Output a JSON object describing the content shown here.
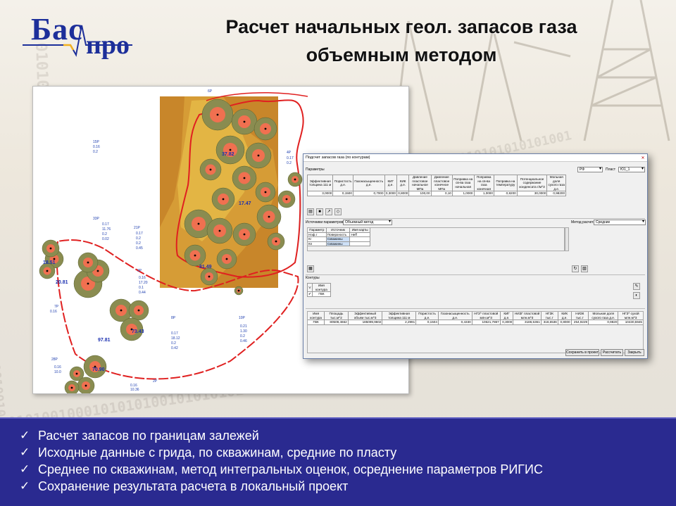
{
  "logo": {
    "part1": "Бас",
    "part2": "про"
  },
  "title": {
    "line1": "Расчет начальных геол. запасов газа",
    "line2": "объемным методом"
  },
  "background": {
    "binary_rows": [
      "0101001010101",
      "1010101010101001",
      "0101001000101010100101010101",
      "10100110101001010"
    ]
  },
  "colors": {
    "band": "#2a2a90",
    "map_orange": "#c8862a",
    "well_olive": "#8a8c50",
    "well_core": "#f07050",
    "contour_red": "#e02020"
  },
  "map": {
    "well_labels": [
      {
        "name": "15P",
        "vals": [
          "0.16",
          "0.2"
        ]
      },
      {
        "name": "16P",
        "vals": [
          "0.16"
        ]
      },
      {
        "name": "33P",
        "vals": [
          "0.17",
          "11.76",
          "0.2",
          "0.02"
        ]
      },
      {
        "name": "21P",
        "vals": [
          "0.17",
          "0.2",
          "0.2",
          "0.45"
        ]
      },
      {
        "name": "3P",
        "vals": [
          "0.16",
          "17.20",
          "0.1",
          "0.44"
        ]
      },
      {
        "name": "8P",
        "vals": [
          "0.17",
          "18.12",
          "0.2",
          "0.42"
        ]
      },
      {
        "name": "10P",
        "vals": [
          "0.21",
          "1.30",
          "0.2",
          "0.46"
        ]
      },
      {
        "name": "2P",
        "vals": [
          "0.16",
          "10.36",
          "0.1"
        ]
      },
      {
        "name": "28P",
        "vals": [
          "0.16",
          "10.0",
          "0.2"
        ]
      },
      {
        "name": "7P",
        "vals": [
          "0.16"
        ]
      },
      {
        "name": "4P",
        "vals": [
          "0.17",
          "0.2",
          "0.47"
        ]
      },
      {
        "name": "6P",
        "vals": [
          "0.15",
          "0.4",
          "0.47"
        ]
      }
    ],
    "big_values": [
      "70.90",
      "97.81",
      "73.43",
      "20.81",
      "18.51",
      "37.82",
      "17.47",
      "81.49"
    ]
  },
  "dialog": {
    "title": "Подсчет запасов газа (по контурам)",
    "params_label": "Параметры",
    "rb_value": "РФ",
    "plast_label": "Пласт",
    "plast_value": "Ю1_1",
    "params_headers": [
      "Эффективная толщина 111 м",
      "Пористость д.е.",
      "Газонасыщенность д.е.",
      "КИГ д.е.",
      "КИК д.е.",
      "Давление пластовое начальное МПа",
      "Давление пластовое конечное МПа",
      "Поправка на св-ва газа начальная",
      "Поправка на св-ва газа конечная",
      "Поправка на температуру",
      "Потенциальное содержание конденсата г/м^3",
      "Мольная доля сухого газа д.е."
    ],
    "params_values": [
      "3,0000",
      "0,1500",
      "0,7000",
      "0,3000",
      "0,8000",
      "100,00",
      "0,10",
      "1,0000",
      "1,0000",
      "0,8200",
      "30,0000",
      "0,98200"
    ],
    "sources_label": "Источники параметров",
    "sources_value": "Объемный метод",
    "method_label": "Метод расчета",
    "method_value": "Средние",
    "src_headers": [
      "Параметр",
      "Источник",
      "Имя карты"
    ],
    "src_rows": [
      [
        "Нэф.г",
        "Поверхность",
        "Heff"
      ],
      [
        "Кг",
        "Скважины",
        ""
      ],
      [
        "Кп",
        "Скважины",
        ""
      ]
    ],
    "contours_label": "Контуры",
    "contour_headers": [
      "V",
      "Имя контура"
    ],
    "contour_rows": [
      [
        "✔",
        "ГВК"
      ]
    ],
    "result_headers": [
      "Имя контура",
      "Площадь тыс.м^2",
      "Эффективный объем тыс.м^3",
      "Эффективная толщина 111 м",
      "Пористость д.е.",
      "Газонасыщенность д.е.",
      "НГЗ^ пластовой млн.м^3",
      "КИГ д.е.",
      "НИЗГ пластовой млн.м^3",
      "НГЗК тыс.т",
      "КИК д.е.",
      "НИЗК тыс.т",
      "Мольная доля сухого газа д.е.",
      "НГЗ^ сухой млн.м^3"
    ],
    "result_values": [
      "ГВК",
      "80509,4662",
      "185099,9602",
      "2,2991",
      "0,1504",
      "0,4330",
      "10621,7867",
      "0,3000",
      "3186,5361",
      "318,6536",
      "0,8000",
      "254,9229",
      "0,9820",
      "10430,5945"
    ],
    "btn_save": "Сохранить в проект",
    "btn_calc": "Рассчитать",
    "btn_close": "Закрыть"
  },
  "bullets": [
    "Расчет запасов по границам залежей",
    "Исходные данные с грида, по скважинам, средние по пласту",
    "Среднее по скважинам, метод интегральных оценок, осреднение параметров РИГИС",
    "Сохранение результата расчета в локальный проект"
  ],
  "check_glyph": "✓"
}
